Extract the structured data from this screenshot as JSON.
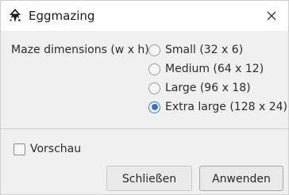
{
  "window": {
    "title": "Eggmazing",
    "app_icon": "inkscape-icon",
    "close_icon": "close-icon"
  },
  "maze": {
    "label": "Maze dimensions (w x h):",
    "options": [
      {
        "label": "Small (32 x 6)",
        "checked": false
      },
      {
        "label": "Medium (64 x 12)",
        "checked": false
      },
      {
        "label": "Large (96 x 18)",
        "checked": false
      },
      {
        "label": "Extra large (128 x 24)",
        "checked": true
      }
    ]
  },
  "preview": {
    "label": "Vorschau",
    "checked": false
  },
  "buttons": {
    "close_label": "Schließen",
    "apply_label": "Anwenden"
  },
  "colors": {
    "accent": "#2f73d4",
    "dialog_bg": "#f0f0f0"
  }
}
